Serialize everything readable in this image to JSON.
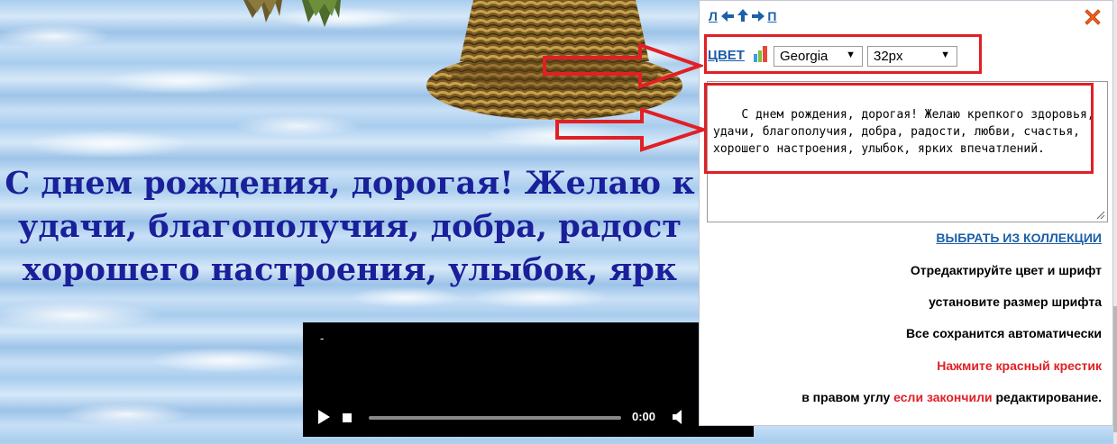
{
  "greeting": {
    "line1": "С днем рождения, дорогая! Желаю к",
    "line2": "удачи, благополучия, добра, радост",
    "line3": "хорошего настроения, улыбок, ярк"
  },
  "player": {
    "title": "-",
    "time": "0:00",
    "progress": 0
  },
  "panel": {
    "arrows": {
      "left_label": "Л",
      "right_label": "П"
    },
    "color_link": "ЦВЕТ",
    "font_select": {
      "value": "Georgia"
    },
    "size_select": {
      "value": "32px"
    },
    "text": "С днем рождения, дорогая! Желаю крепкого здоровья, удачи, благополучия, добра, радости, любви, счастья, хорошего настроения, улыбок, ярких впечатлений.",
    "collection_link": "ВЫБРАТЬ ИЗ КОЛЛЕКЦИИ",
    "info": {
      "line1": "Отредактируйте цвет и шрифт",
      "line2": "установите размер шрифта",
      "line3": "Все сохранится автоматически",
      "line4": "Нажмите красный крестик",
      "line5_a": "в правом углу ",
      "line5_b": "если закончили",
      "line5_c": " редактирование."
    }
  },
  "colors": {
    "greeting": "#1a1f9a",
    "link": "#1d5fa8",
    "highlight": "#e11f25"
  },
  "icons": [
    "arrow-left-icon",
    "arrow-up-icon",
    "arrow-right-icon",
    "close-icon",
    "color-swatch-icon",
    "play-icon",
    "stop-icon",
    "volume-icon",
    "resize-grip-icon"
  ]
}
